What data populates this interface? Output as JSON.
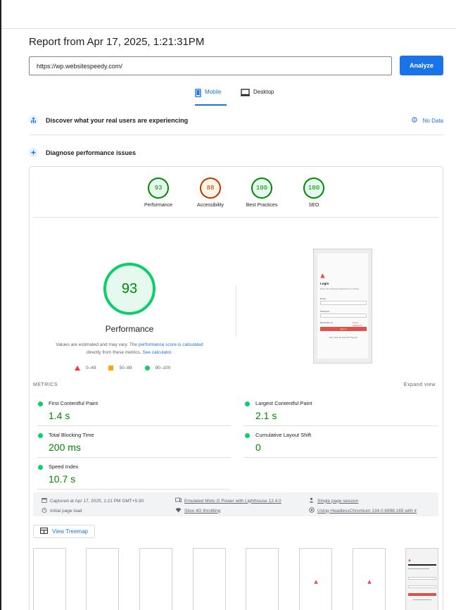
{
  "report": {
    "title": "Report from Apr 17, 2025, 1:21:31PM"
  },
  "url_input": {
    "value": "https://wp.websitespeedy.com/"
  },
  "analyze_label": "Analyze",
  "tabs": [
    {
      "label": "Mobile",
      "active": true
    },
    {
      "label": "Desktop",
      "active": false
    }
  ],
  "discover": {
    "text": "Discover what your real users are experiencing",
    "nodata": "No Data"
  },
  "diagnose": {
    "text": "Diagnose performance issues"
  },
  "categories": [
    {
      "score": "93",
      "label": "Performance",
      "status": "pass"
    },
    {
      "score": "88",
      "label": "Accessibility",
      "status": "average"
    },
    {
      "score": "100",
      "label": "Best Practices",
      "status": "pass"
    },
    {
      "score": "100",
      "label": "SEO",
      "status": "pass"
    }
  ],
  "main_score": {
    "value": "93",
    "label": "Performance"
  },
  "note": {
    "part1": "Values are estimated and may vary. The ",
    "link1": "performance score is calculated",
    "part2": " directly from these metrics. ",
    "link2": "See calculator."
  },
  "legend": {
    "fail": "0–49",
    "average": "50–89",
    "pass": "90–100"
  },
  "colors": {
    "pass": "#0cce6b",
    "average": "#ffa400",
    "fail": "#ff3333",
    "accent": "#1a73e8"
  },
  "phone_preview": {
    "title": "Login",
    "subtitle": "Enter the email and password to continue",
    "email_label": "Email",
    "password_label": "Password",
    "remember": "Remember me",
    "forgot": "Forgot Password?",
    "button": "Sign in",
    "footer": "Don't have an account? Sign Up"
  },
  "metrics": {
    "header": "METRICS",
    "expand": "Expand view",
    "items": [
      {
        "name": "First Contentful Paint",
        "value": "1.4 s"
      },
      {
        "name": "Largest Contentful Paint",
        "value": "2.1 s"
      },
      {
        "name": "Total Blocking Time",
        "value": "200 ms"
      },
      {
        "name": "Cumulative Layout Shift",
        "value": "0"
      },
      {
        "name": "Speed Index",
        "value": "10.7 s"
      }
    ]
  },
  "info": {
    "captured": "Captured at Apr 17, 2025, 1:21 PM GMT+5:30",
    "initial": "Initial page load",
    "device": "Emulated Moto G Power with Lighthouse 12.4.0",
    "throttling": "Slow 4G throttling",
    "session": "Single page session",
    "browser": "Using HeadlessChromium 134.0.6998.165 with lr"
  },
  "treemap_label": "View Treemap"
}
